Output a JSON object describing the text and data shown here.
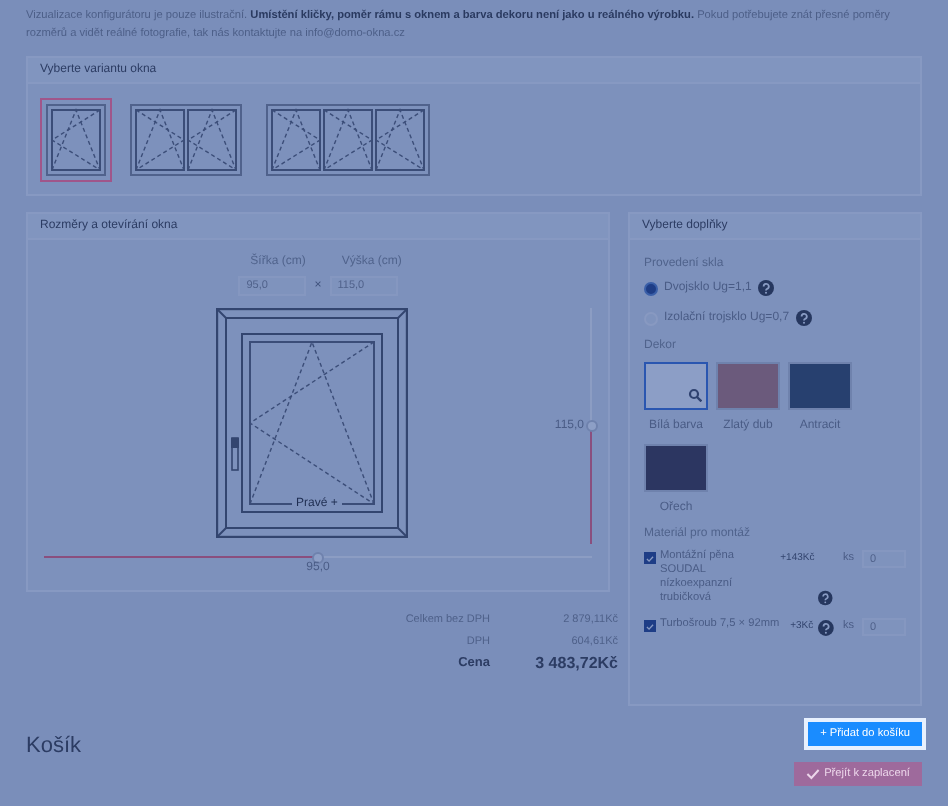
{
  "notice": "Vizualizace konfigurátoru je pouze ilustrační. **Umístění kličky, poměr rámu s oknem a barva dekoru není jako u reálného výrobku.** Pokud potřebujete znát přesné poměry rozměrů a vidět reálné fotografie, tak nás kontaktujte na info@domo-okna.cz",
  "variant_panel": {
    "title": "Vyberte variantu okna",
    "variants": [
      {
        "kind": "single",
        "selected": true
      },
      {
        "kind": "double",
        "selected": false
      },
      {
        "kind": "triple",
        "selected": false
      }
    ]
  },
  "dimensions_panel": {
    "title": "Rozměry a otevírání okna",
    "width_label": "Šířka (cm)",
    "height_label": "Výška (cm)",
    "width_value": "95,0",
    "times": "×",
    "height_value": "115,0",
    "opening_label": "Pravé +",
    "height_slider": {
      "level": 0.5,
      "reading": "115,0"
    },
    "width_slider": {
      "level": 0.5,
      "reading": "95,0"
    }
  },
  "prices": [
    {
      "kind": "line",
      "label": "Celkem bez DPH",
      "value": "2 879,11Kč"
    },
    {
      "kind": "line",
      "label": "DPH",
      "value": "604,61Kč"
    },
    {
      "kind": "total",
      "label": "Cena",
      "value": "3 483,72Kč"
    }
  ],
  "extras_panel": {
    "title": "Vyberte doplňky",
    "glass": {
      "label": "Provedení skla",
      "options": [
        {
          "label": "Dvojsklo Ug=1,1",
          "selected": true,
          "help": true
        },
        {
          "label": "Izolační trojsklo Ug=0,7",
          "selected": false,
          "help": true
        }
      ]
    },
    "decor": {
      "label": "Dekor",
      "options": [
        {
          "label": "Bílá barva",
          "color": "#8c9ec6",
          "selected": true
        },
        {
          "label": "Zlatý dub",
          "color": "#6b5a7c",
          "selected": false
        },
        {
          "label": "Antracit",
          "color": "#27406f",
          "selected": false
        },
        {
          "label": "Ořech",
          "color": "#2c3661",
          "selected": false
        }
      ]
    },
    "mounting": {
      "label": "Materiál pro montáž",
      "items": [
        {
          "label": "Montážní pěna SOUDAL nízkoexpanzní trubičková",
          "price": "+143Kč",
          "checked": true,
          "help": true,
          "unit": "ks",
          "quantity": "0"
        },
        {
          "label": "Turbošroub 7,5 × 92mm",
          "price": "+3Kč",
          "checked": true,
          "help": true,
          "unit": "ks",
          "quantity": "0"
        }
      ]
    }
  },
  "cart": {
    "title": "Košík",
    "add_button": {
      "label": "+ Přidat do košíku",
      "highlighted": true
    },
    "pay_button": {
      "label": "Přejít k zaplacení",
      "disabled": true
    }
  }
}
